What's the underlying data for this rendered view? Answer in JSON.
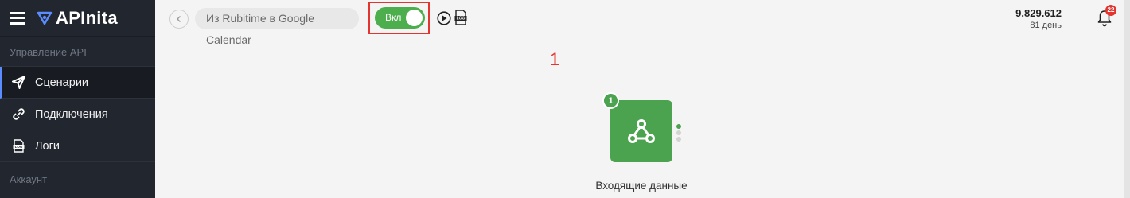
{
  "sidebar": {
    "brand": "APInita",
    "section_api": "Управление API",
    "items": [
      {
        "label": "Сценарии",
        "icon": "send-icon",
        "active": true
      },
      {
        "label": "Подключения",
        "icon": "link-icon",
        "active": false
      },
      {
        "label": "Логи",
        "icon": "log-file-icon",
        "active": false
      }
    ],
    "section_account": "Аккаунт"
  },
  "topbar": {
    "scenario_name": "Из Rubitime в Google Calendar",
    "toggle_label": "Вкл",
    "toggle_on": true,
    "annotation": "1",
    "balance_amount": "9.829.612",
    "balance_days": "81 день",
    "notification_count": "22"
  },
  "canvas": {
    "node_number": "1",
    "node_label": "Входящие данные",
    "node_icon": "webhook-icon"
  },
  "colors": {
    "sidebar_bg": "#22262e",
    "accent": "#5a8cff",
    "success": "#4ca34f",
    "annotation": "#e3342f"
  }
}
